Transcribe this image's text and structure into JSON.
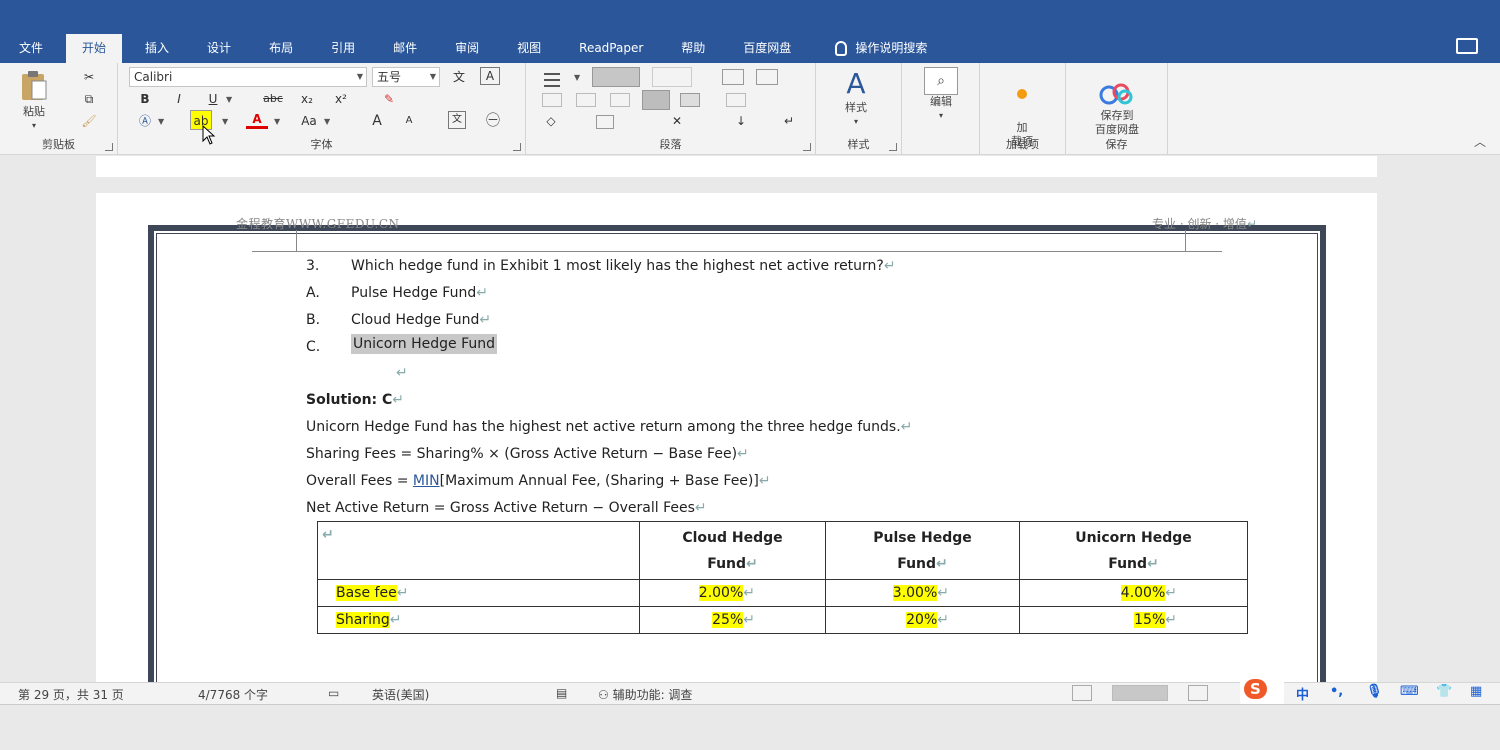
{
  "tabs": [
    "文件",
    "开始",
    "插入",
    "设计",
    "布局",
    "引用",
    "邮件",
    "审阅",
    "视图",
    "ReadPaper",
    "帮助",
    "百度网盘"
  ],
  "active_tab": "开始",
  "tell_me": "操作说明搜索",
  "ribbon": {
    "clipboard": {
      "paste": "粘贴",
      "label": "剪贴板"
    },
    "font": {
      "font_name": "Calibri",
      "font_size": "五号",
      "label": "字体",
      "bold": "B",
      "italic": "I",
      "underline": "U",
      "strike": "abc",
      "sub": "x₂",
      "sup": "x²",
      "change_case": "Aa",
      "grow": "A",
      "shrink": "A",
      "char_border": "A"
    },
    "paragraph": {
      "label": "段落"
    },
    "styles": {
      "button": "样式",
      "label": "样式"
    },
    "editing": {
      "button": "编辑"
    },
    "addins": {
      "button": "加\n载项",
      "label": "加载项"
    },
    "save": {
      "button": "保存到\n百度网盘",
      "label": "保存"
    }
  },
  "header": {
    "left": "金程教育WWW.GFEDU.CN",
    "right": "专业 · 创新 · 增值"
  },
  "question": {
    "number": "3.",
    "text": "Which hedge fund in Exhibit 1 most likely has the highest net active return?",
    "options": [
      {
        "label": "A.",
        "text": "Pulse Hedge Fund"
      },
      {
        "label": "B.",
        "text": "Cloud Hedge Fund"
      },
      {
        "label": "C.",
        "text": "Unicorn Hedge Fund"
      }
    ]
  },
  "solution": {
    "title": "Solution: C",
    "line1": "Unicorn Hedge Fund has the highest net active return among the three hedge funds.",
    "line2": "Sharing Fees = Sharing% × (Gross Active Return − Base Fee)",
    "line3_pre": "Overall Fees = ",
    "line3_link": "MIN",
    "line3_post": "[Maximum Annual Fee, (Sharing + Base Fee)]",
    "line4": "Net Active Return = Gross Active Return − Overall Fees"
  },
  "table": {
    "headers": [
      [
        "Cloud  Hedge",
        "Fund"
      ],
      [
        "Pulse     Hedge",
        "Fund"
      ],
      [
        "Unicorn      Hedge",
        "Fund"
      ]
    ],
    "rows": [
      {
        "label": "Base fee",
        "values": [
          "2.00%",
          "3.00%",
          "4.00%"
        ]
      },
      {
        "label": "Sharing",
        "values": [
          "25%",
          "20%",
          "15%"
        ]
      }
    ]
  },
  "status": {
    "page": "第 29 页，共 31 页",
    "words": "4/7768 个字",
    "language": "英语(美国)",
    "accessibility": "辅助功能: 调查"
  },
  "ime": {
    "lang": "中"
  },
  "colors": {
    "accent": "#2b579a",
    "highlight": "#ffff00"
  }
}
